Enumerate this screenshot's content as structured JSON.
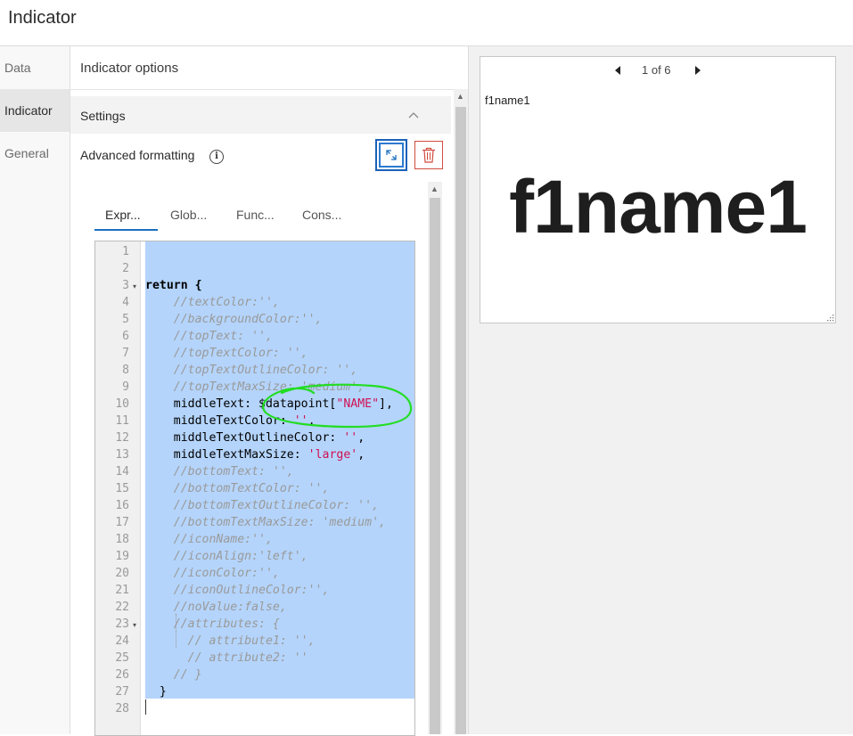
{
  "header": {
    "title": "Indicator"
  },
  "nav": {
    "items": [
      {
        "label": "Data"
      },
      {
        "label": "Indicator"
      },
      {
        "label": "General"
      }
    ]
  },
  "panel": {
    "title": "Indicator options",
    "settings_label": "Settings",
    "advanced_label": "Advanced formatting",
    "info_glyph": "i"
  },
  "tabs": [
    {
      "label": "Expr..."
    },
    {
      "label": "Glob..."
    },
    {
      "label": "Func..."
    },
    {
      "label": "Cons..."
    }
  ],
  "code": {
    "lines": [
      "",
      "",
      "return {",
      "    //textColor:'',",
      "    //backgroundColor:'',",
      "    //topText: '',",
      "    //topTextColor: '',",
      "    //topTextOutlineColor: '',",
      "    //topTextMaxSize: 'medium',",
      "    middleText: $datapoint[\"NAME\"],",
      "    middleTextColor: '',",
      "    middleTextOutlineColor: '',",
      "    middleTextMaxSize: 'large',",
      "    //bottomText: '',",
      "    //bottomTextColor: '',",
      "    //bottomTextOutlineColor: '',",
      "    //bottomTextMaxSize: 'medium',",
      "    //iconName:'',",
      "    //iconAlign:'left',",
      "    //iconColor:'',",
      "    //iconOutlineColor:'',",
      "    //noValue:false,",
      "    //attributes: {",
      "      // attribute1: '',",
      "      // attribute2: ''",
      "    // }",
      "  }",
      ""
    ]
  },
  "preview": {
    "pager": "1 of 6",
    "top_text": "f1name1",
    "middle_text": "f1name1"
  },
  "colors": {
    "accent": "#1d6fbf",
    "danger": "#d14b3d",
    "selection": "#b4d4fb",
    "annotation": "#22dd22"
  },
  "icons": [
    "expand-icon",
    "trash-icon",
    "info-icon",
    "chevron-up-icon",
    "caret-left-icon",
    "caret-right-icon",
    "resize-grip-icon"
  ]
}
